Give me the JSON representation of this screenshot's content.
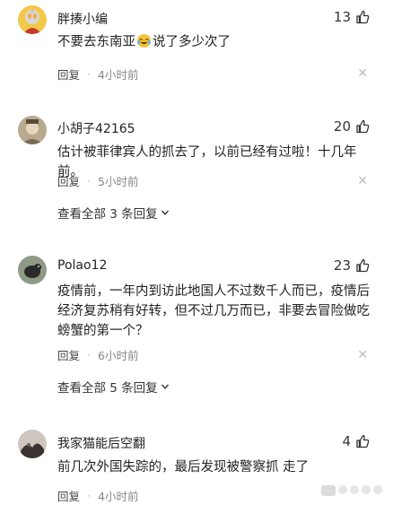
{
  "comments": [
    {
      "username": "胖揍小编",
      "likes": "13",
      "text_before_emoji": "不要去东南亚",
      "emoji": "crying-laughing-emoji",
      "text_after_emoji": "说了多少次了",
      "reply_label": "回复",
      "time": "4小时前"
    },
    {
      "username": "小胡子42165",
      "likes": "20",
      "text": "估计被菲律宾人的抓去了，以前已经有过啦！十几年前。",
      "reply_label": "回复",
      "time": "5小时前",
      "view_all": "查看全部 3 条回复"
    },
    {
      "username": "Polao12",
      "likes": "23",
      "text": "疫情前，一年内到访此地国人不过数千人而已，疫情后经济复苏稍有好转，但不过几万而已，非要去冒险做吃螃蟹的第一个？",
      "reply_label": "回复",
      "time": "6小时前",
      "view_all": "查看全部 5 条回复"
    },
    {
      "username": "我家猫能后空翻",
      "likes": "4",
      "text": "前几次外国失踪的，最后发现被警察抓 走了",
      "reply_label": "回复",
      "time": "4小时前"
    }
  ],
  "icons": {
    "like": "thumbs-up-icon",
    "dismiss": "close-icon",
    "expand": "chevron-down-icon"
  },
  "colors": {
    "text": "#222222",
    "meta": "#888888",
    "icon": "#bbbbbb"
  }
}
